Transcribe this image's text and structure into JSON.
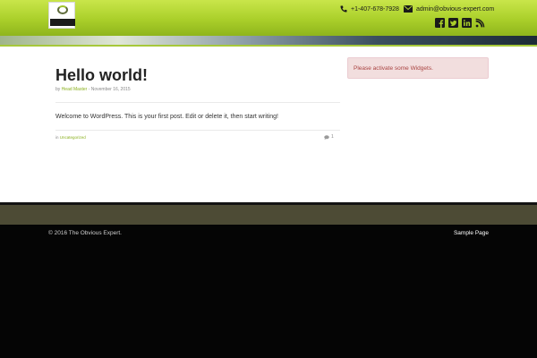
{
  "header": {
    "phone": "+1-407-678-7928",
    "email": "admin@obvious-expert.com",
    "social_icons": [
      "facebook-icon",
      "twitter-icon",
      "linkedin-icon",
      "rss-icon"
    ],
    "accent_color": "#a6c83a"
  },
  "post": {
    "title": "Hello world!",
    "meta_by": "by",
    "author": "Head Master",
    "meta_sep": "- November 16, 2015",
    "body": "Welcome to WordPress. This is your first post. Edit or delete it, then start writing!",
    "category_prefix": "in",
    "category": "Uncategorized",
    "comment_count": "1"
  },
  "sidebar": {
    "alert": "Please activate some Widgets."
  },
  "footer": {
    "copyright": "© 2016 The Obvious Expert.",
    "link": "Sample Page"
  }
}
